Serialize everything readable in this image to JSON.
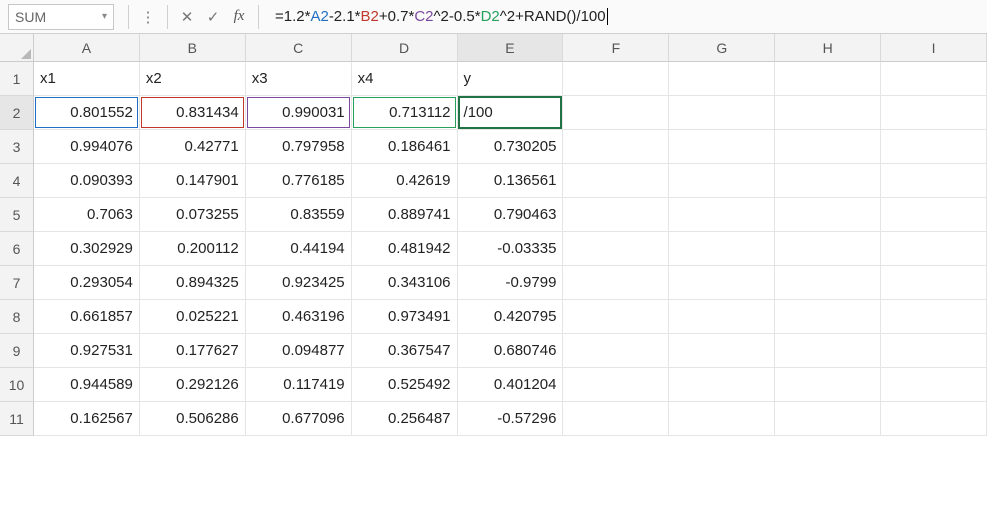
{
  "name_box": "SUM",
  "formula_parts": {
    "p1": "=1.2*",
    "a": "A2",
    "p2": "-2.1*",
    "b": "B2",
    "p3": "+0.7*",
    "c": "C2",
    "p4": "^2-0.5*",
    "d": "D2",
    "p5": "^2+RAND()/100"
  },
  "columns": [
    "A",
    "B",
    "C",
    "D",
    "E",
    "F",
    "G",
    "H",
    "I"
  ],
  "row_numbers": [
    "1",
    "2",
    "3",
    "4",
    "5",
    "6",
    "7",
    "8",
    "9",
    "10",
    "11"
  ],
  "headers": {
    "A": "x1",
    "B": "x2",
    "C": "x3",
    "D": "x4",
    "E": "y"
  },
  "editing_cell_display": "/100",
  "chart_data": {
    "type": "table",
    "columns": [
      "x1",
      "x2",
      "x3",
      "x4",
      "y"
    ],
    "rows": [
      [
        0.801552,
        0.831434,
        0.990031,
        0.713112,
        null
      ],
      [
        0.994076,
        0.42771,
        0.797958,
        0.186461,
        0.730205
      ],
      [
        0.090393,
        0.147901,
        0.776185,
        0.42619,
        0.136561
      ],
      [
        0.7063,
        0.073255,
        0.83559,
        0.889741,
        0.790463
      ],
      [
        0.302929,
        0.200112,
        0.44194,
        0.481942,
        -0.03335
      ],
      [
        0.293054,
        0.894325,
        0.923425,
        0.343106,
        -0.9799
      ],
      [
        0.661857,
        0.025221,
        0.463196,
        0.973491,
        0.420795
      ],
      [
        0.927531,
        0.177627,
        0.094877,
        0.367547,
        0.680746
      ],
      [
        0.944589,
        0.292126,
        0.117419,
        0.525492,
        0.401204
      ],
      [
        0.162567,
        0.506286,
        0.677096,
        0.256487,
        -0.57296
      ]
    ]
  },
  "cells": {
    "r2": {
      "A": "0.801552",
      "B": "0.831434",
      "C": "0.990031",
      "D": "0.713112"
    },
    "r3": {
      "A": "0.994076",
      "B": "0.42771",
      "C": "0.797958",
      "D": "0.186461",
      "E": "0.730205"
    },
    "r4": {
      "A": "0.090393",
      "B": "0.147901",
      "C": "0.776185",
      "D": "0.42619",
      "E": "0.136561"
    },
    "r5": {
      "A": "0.7063",
      "B": "0.073255",
      "C": "0.83559",
      "D": "0.889741",
      "E": "0.790463"
    },
    "r6": {
      "A": "0.302929",
      "B": "0.200112",
      "C": "0.44194",
      "D": "0.481942",
      "E": "-0.03335"
    },
    "r7": {
      "A": "0.293054",
      "B": "0.894325",
      "C": "0.923425",
      "D": "0.343106",
      "E": "-0.9799"
    },
    "r8": {
      "A": "0.661857",
      "B": "0.025221",
      "C": "0.463196",
      "D": "0.973491",
      "E": "0.420795"
    },
    "r9": {
      "A": "0.927531",
      "B": "0.177627",
      "C": "0.094877",
      "D": "0.367547",
      "E": "0.680746"
    },
    "r10": {
      "A": "0.944589",
      "B": "0.292126",
      "C": "0.117419",
      "D": "0.525492",
      "E": "0.401204"
    },
    "r11": {
      "A": "0.162567",
      "B": "0.506286",
      "C": "0.677096",
      "D": "0.256487",
      "E": "-0.57296"
    }
  }
}
